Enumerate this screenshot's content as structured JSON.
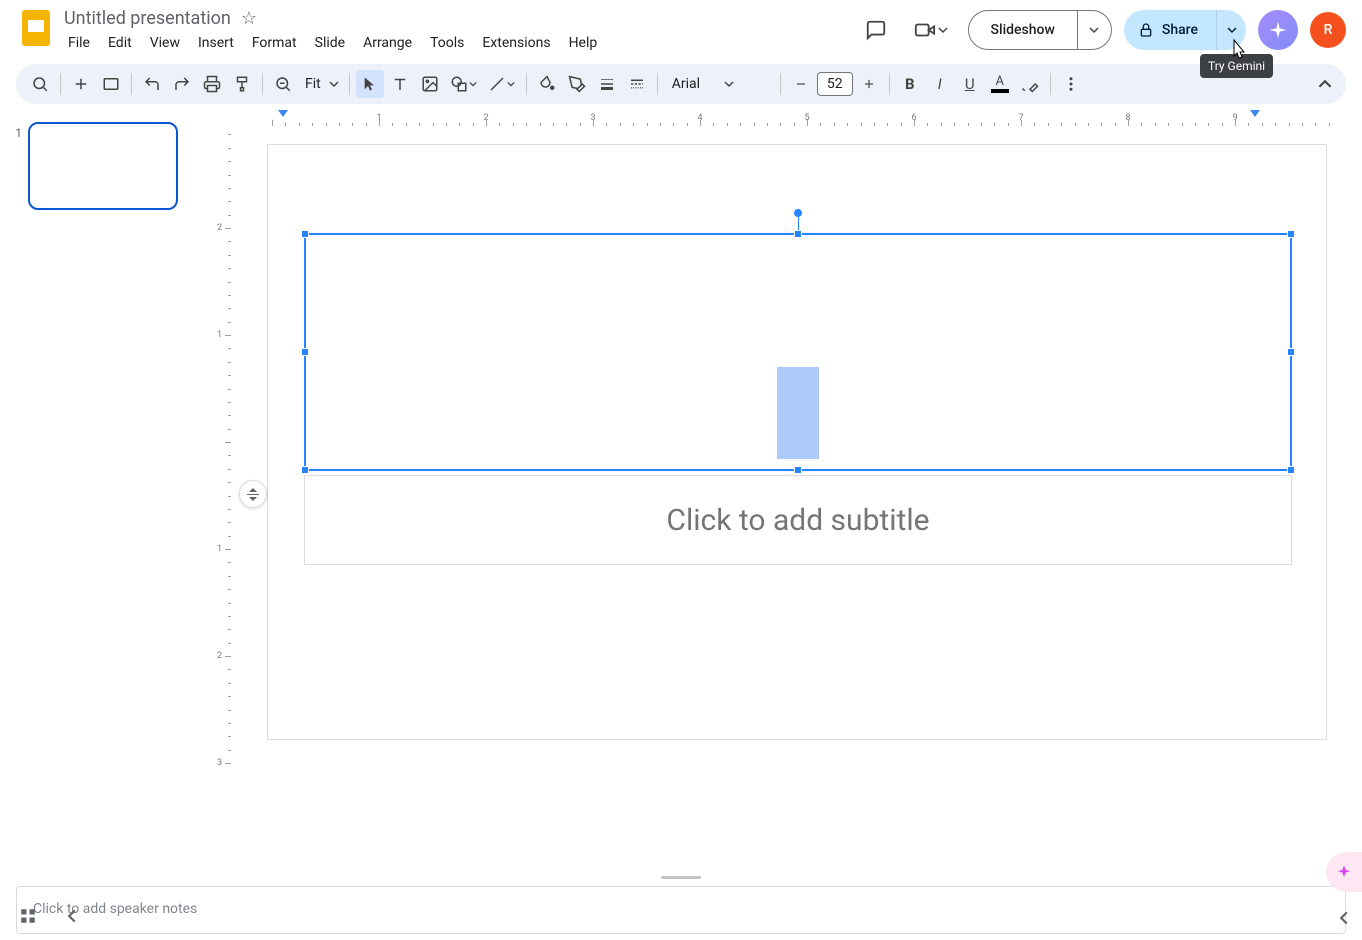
{
  "app": {
    "doc_title": "Untitled presentation",
    "account_initial": "R",
    "tooltip_gemini": "Try Gemini"
  },
  "menu": {
    "items": [
      "File",
      "Edit",
      "View",
      "Insert",
      "Format",
      "Slide",
      "Arrange",
      "Tools",
      "Extensions",
      "Help"
    ]
  },
  "header_actions": {
    "slideshow": "Slideshow",
    "share": "Share"
  },
  "toolbar": {
    "zoom_label": "Fit",
    "font_name": "Arial",
    "font_size": "52"
  },
  "filmstrip": {
    "slides": [
      {
        "index": "1",
        "selected": true
      }
    ]
  },
  "canvas": {
    "subtitle_placeholder": "Click to add subtitle"
  },
  "notes": {
    "placeholder": "Click to add speaker notes"
  },
  "ruler": {
    "h_numbers": [
      "1",
      "2",
      "3",
      "4",
      "5",
      "6",
      "7",
      "8",
      "9"
    ],
    "v_numbers": [
      "2",
      "1",
      "1",
      "2",
      "3"
    ]
  }
}
